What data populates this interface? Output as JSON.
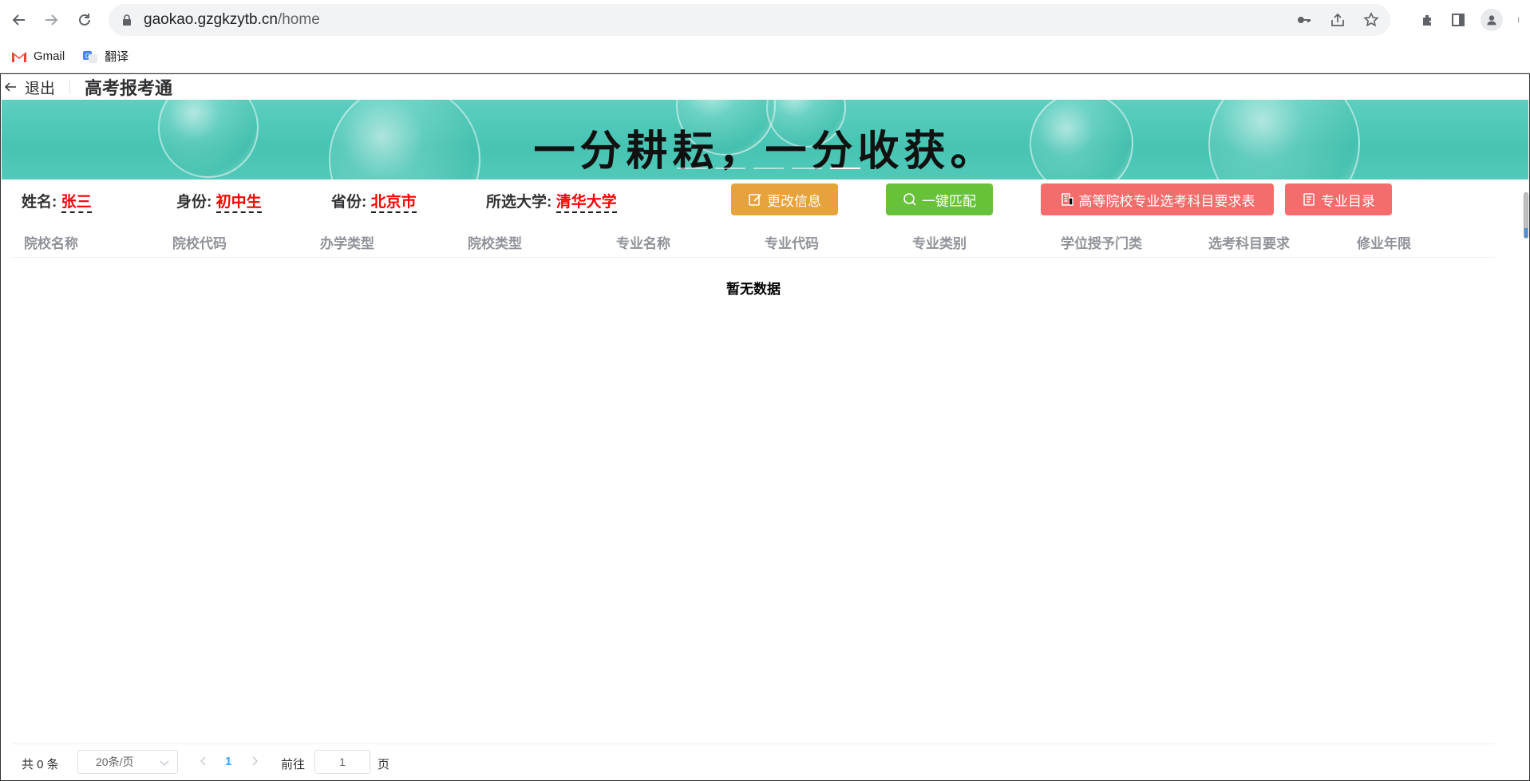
{
  "browser": {
    "url_host": "gaokao.gzgkzytb.cn",
    "url_path": "/home",
    "bookmarks": [
      {
        "label": "Gmail",
        "icon": "gmail-icon"
      },
      {
        "label": "翻译",
        "icon": "translate-icon"
      }
    ]
  },
  "header": {
    "back_label": "退出",
    "title": "高考报考通"
  },
  "banner": {
    "slogan": "一分耕耘，一分收获。"
  },
  "profile": {
    "name_label": "姓名:",
    "name_value": "张三",
    "identity_label": "身份:",
    "identity_value": "初中生",
    "province_label": "省份:",
    "province_value": "北京市",
    "university_label": "所选大学:",
    "university_value": "清华大学"
  },
  "actions": {
    "edit_info": "更改信息",
    "one_click_match": "一键匹配",
    "subject_requirements": "高等院校专业选考科目要求表",
    "major_catalog": "专业目录"
  },
  "table": {
    "columns": [
      "院校名称",
      "院校代码",
      "办学类型",
      "院校类型",
      "专业名称",
      "专业代码",
      "专业类别",
      "学位授予门类",
      "选考科目要求",
      "修业年限"
    ],
    "rows": [],
    "empty_text": "暂无数据"
  },
  "pagination": {
    "total_text": "共 0 条",
    "page_size": "20条/页",
    "current_page": "1",
    "goto_label": "前往",
    "goto_value": "1",
    "page_unit": "页"
  },
  "colors": {
    "orange": "#e6a23c",
    "green": "#67c23a",
    "red": "#f56c6c",
    "highlight": "#ff0000",
    "link_blue": "#409eff"
  }
}
